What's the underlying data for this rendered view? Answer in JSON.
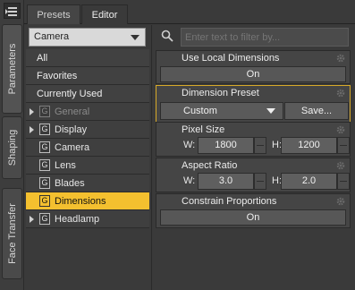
{
  "vertical_tabs": [
    "Parameters",
    "Shaping",
    "Face Transfer"
  ],
  "top_tabs": [
    "Presets",
    "Editor"
  ],
  "category_dropdown": {
    "value": "Camera"
  },
  "categories_flat": [
    "All",
    "Favorites",
    "Currently Used"
  ],
  "categories_tree": [
    {
      "label": "General",
      "icon": "G",
      "expandable": true,
      "disabled": true,
      "selected": false
    },
    {
      "label": "Display",
      "icon": "G",
      "expandable": true,
      "disabled": false,
      "selected": false
    },
    {
      "label": "Camera",
      "icon": "G",
      "expandable": false,
      "disabled": false,
      "selected": false
    },
    {
      "label": "Lens",
      "icon": "G",
      "expandable": false,
      "disabled": false,
      "selected": false
    },
    {
      "label": "Blades",
      "icon": "G",
      "expandable": false,
      "disabled": false,
      "selected": false
    },
    {
      "label": "Dimensions",
      "icon": "G",
      "expandable": false,
      "disabled": false,
      "selected": true
    },
    {
      "label": "Headlamp",
      "icon": "G",
      "expandable": true,
      "disabled": false,
      "selected": false
    }
  ],
  "search": {
    "placeholder": "Enter text to filter by..."
  },
  "properties": {
    "use_local_dimensions": {
      "title": "Use Local Dimensions",
      "value": "On"
    },
    "dimension_preset": {
      "title": "Dimension Preset",
      "value": "Custom",
      "save_label": "Save..."
    },
    "pixel_size": {
      "title": "Pixel Size",
      "w_label": "W:",
      "w_value": "1800",
      "h_label": "H:",
      "h_value": "1200"
    },
    "aspect_ratio": {
      "title": "Aspect Ratio",
      "w_label": "W:",
      "w_value": "3.0",
      "h_label": "H:",
      "h_value": "2.0"
    },
    "constrain_proportions": {
      "title": "Constrain Proportions",
      "value": "On"
    }
  },
  "colors": {
    "selection": "#f4c02f",
    "highlight_border": "#d7a928",
    "panel_bg": "#3a3a3a"
  }
}
